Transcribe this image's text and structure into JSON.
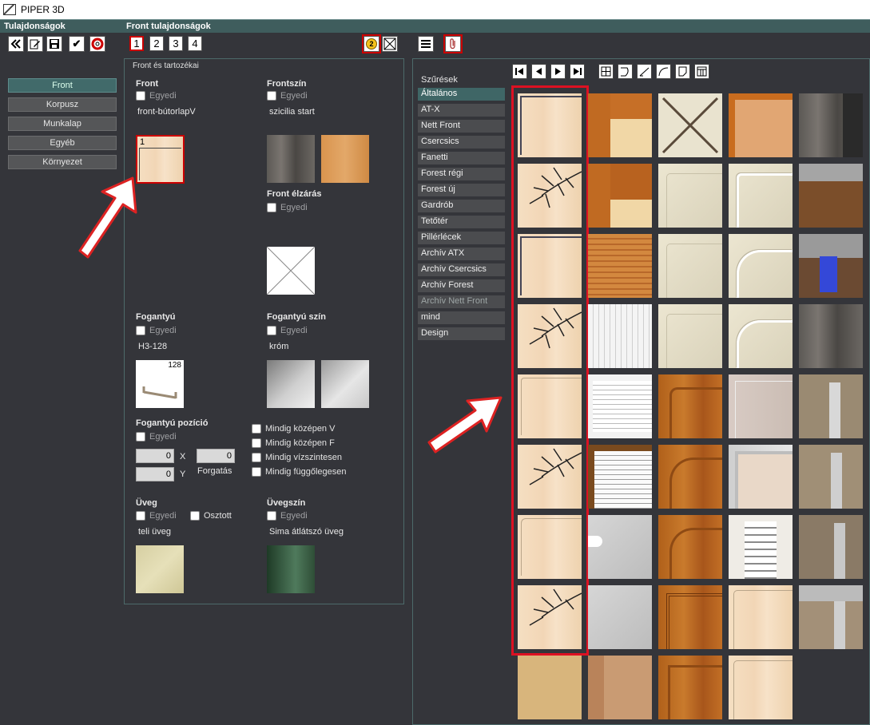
{
  "app": {
    "title": "PIPER 3D"
  },
  "header": {
    "left_title": "Tulajdonságok",
    "right_title": "Front tulajdonságok"
  },
  "toolbar": {
    "icons": [
      "collapse-left-icon",
      "edit-document-icon",
      "save-icon",
      "checkmark-icon",
      "help-lifebuoy-icon"
    ],
    "check_glyph": "✔"
  },
  "tabs": [
    "1",
    "2",
    "3",
    "4"
  ],
  "top_icons": {
    "help_number": "2"
  },
  "left_nav": [
    "Front",
    "Korpusz",
    "Munkalap",
    "Egyéb",
    "Környezet"
  ],
  "panel": {
    "title": "Front és tartozékai",
    "front": {
      "label": "Front",
      "custom": "Egyedi",
      "value": "front-bútorlapV",
      "thumb_number": "1"
    },
    "front_color": {
      "label": "Frontszín",
      "custom": "Egyedi",
      "value": "szicilia start"
    },
    "edge": {
      "label": "Front élzárás",
      "custom": "Egyedi"
    },
    "handle": {
      "label": "Fogantyú",
      "custom": "Egyedi",
      "value": "H3-128",
      "thumb_number": "128"
    },
    "handle_color": {
      "label": "Fogantyú szín",
      "custom": "Egyedi",
      "value": "króm"
    },
    "handle_position": {
      "label": "Fogantyú pozíció",
      "custom": "Egyedi",
      "x_value": "0",
      "x_label": "X",
      "y_value": "0",
      "y_label": "Y",
      "rotation_value": "0",
      "rotation_label": "Forgatás",
      "options": [
        "Mindig középen V",
        "Mindig középen F",
        "Mindig vízszintesen",
        "Mindig függőlegesen"
      ]
    },
    "glass": {
      "label": "Üveg",
      "custom": "Egyedi",
      "divided": "Osztott",
      "value": "teli üveg"
    },
    "glass_color": {
      "label": "Üvegszín",
      "custom": "Egyedi",
      "value": "Sima átlátszó üveg"
    }
  },
  "filters": {
    "title": "Szűrések",
    "items": [
      "Általános",
      "AT-X",
      "Nett Front",
      "Csercsics",
      "Fanetti",
      "Forest régi",
      "Forest új",
      "Gardrób",
      "Tetőtér",
      "Pillérlécek",
      "Archív ATX",
      "Archív Csercsics",
      "Archív Forest",
      "Archív Nett Front",
      "mind",
      "Design"
    ],
    "active": "Általános"
  },
  "gallery_toolbar": [
    "first-page-icon",
    "prev-page-icon",
    "next-page-icon",
    "last-page-icon",
    "grid-view-icon",
    "edge-round-icon",
    "edge-slope-icon",
    "edge-curve-icon",
    "document-corner-icon",
    "profile-icon"
  ],
  "colors": {
    "accent_teal": "#3f5d5d",
    "highlight_red": "#cc0000",
    "background": "#34353a"
  }
}
